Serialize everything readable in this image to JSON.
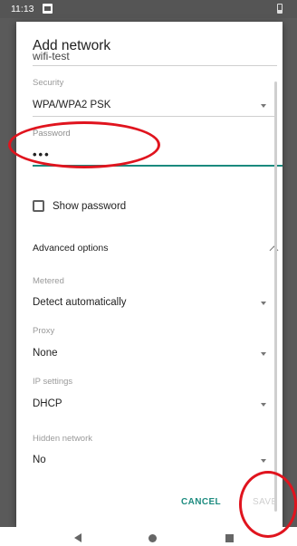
{
  "status_bar": {
    "time": "11:13"
  },
  "dialog": {
    "title": "Add network",
    "network_name_value": "wifi-test",
    "security": {
      "label": "Security",
      "value": "WPA/WPA2 PSK"
    },
    "password": {
      "label": "Password",
      "value": "•••"
    },
    "show_password_label": "Show password",
    "advanced_options_label": "Advanced options",
    "metered": {
      "label": "Metered",
      "value": "Detect automatically"
    },
    "proxy": {
      "label": "Proxy",
      "value": "None"
    },
    "ip_settings": {
      "label": "IP settings",
      "value": "DHCP"
    },
    "hidden_network": {
      "label": "Hidden network",
      "value": "No"
    },
    "buttons": {
      "cancel": "CANCEL",
      "save": "SAVE"
    }
  },
  "colors": {
    "accent": "#1a8a7e",
    "annotation": "#e0141e",
    "disabled": "#cfcfcf"
  },
  "icons": [
    "notification-icon",
    "battery-icon",
    "dropdown-arrow-icon",
    "chevron-up-icon",
    "back-icon",
    "home-icon",
    "recents-icon"
  ]
}
